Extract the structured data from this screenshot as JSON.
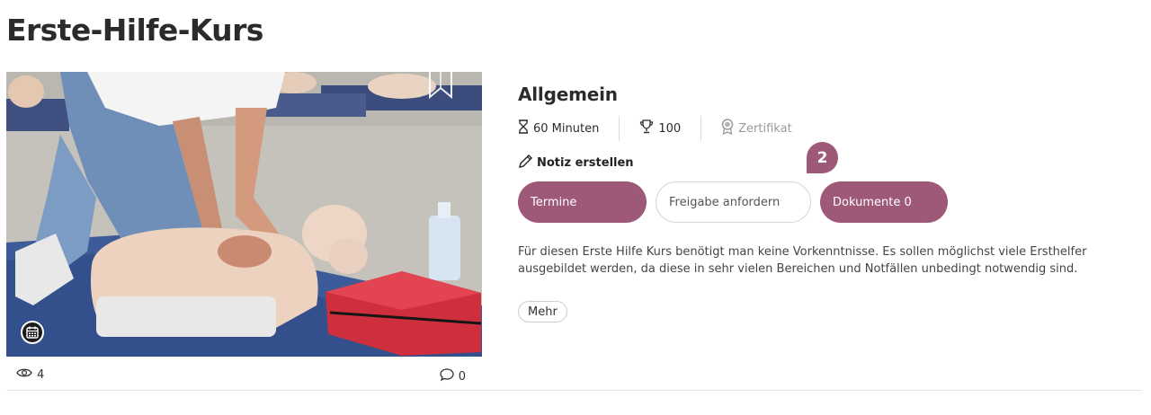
{
  "page": {
    "title": "Erste-Hilfe-Kurs"
  },
  "media": {
    "bookmark_icon": "bookmark-icon",
    "calendar_icon": "calendar-icon",
    "views_icon": "eye-icon",
    "views": "4",
    "comments_icon": "comment-icon",
    "comments": "0"
  },
  "details": {
    "section_title": "Allgemein",
    "duration": "60 Minuten",
    "duration_icon": "hourglass-icon",
    "points": "100",
    "points_icon": "trophy-icon",
    "certificate": "Zertifikat",
    "certificate_icon": "award-icon",
    "note_label": "Notiz erstellen",
    "note_icon": "pencil-icon"
  },
  "actions": {
    "termine_label": "Termine",
    "freigabe_label": "Freigabe anfordern",
    "dokumente_label": "Dokumente 0",
    "count_bubble": "2"
  },
  "description": "Für diesen Erste Hilfe Kurs benötigt man keine Vorkenntnisse. Es sollen möglichst viele Ersthelfer ausgebildet werden, da diese in sehr vielen Bereichen und Notfällen unbedingt notwendig sind.",
  "more_label": "Mehr",
  "colors": {
    "accent": "#9e5878",
    "text": "#2b2b2b",
    "muted": "#9a9a9a"
  }
}
